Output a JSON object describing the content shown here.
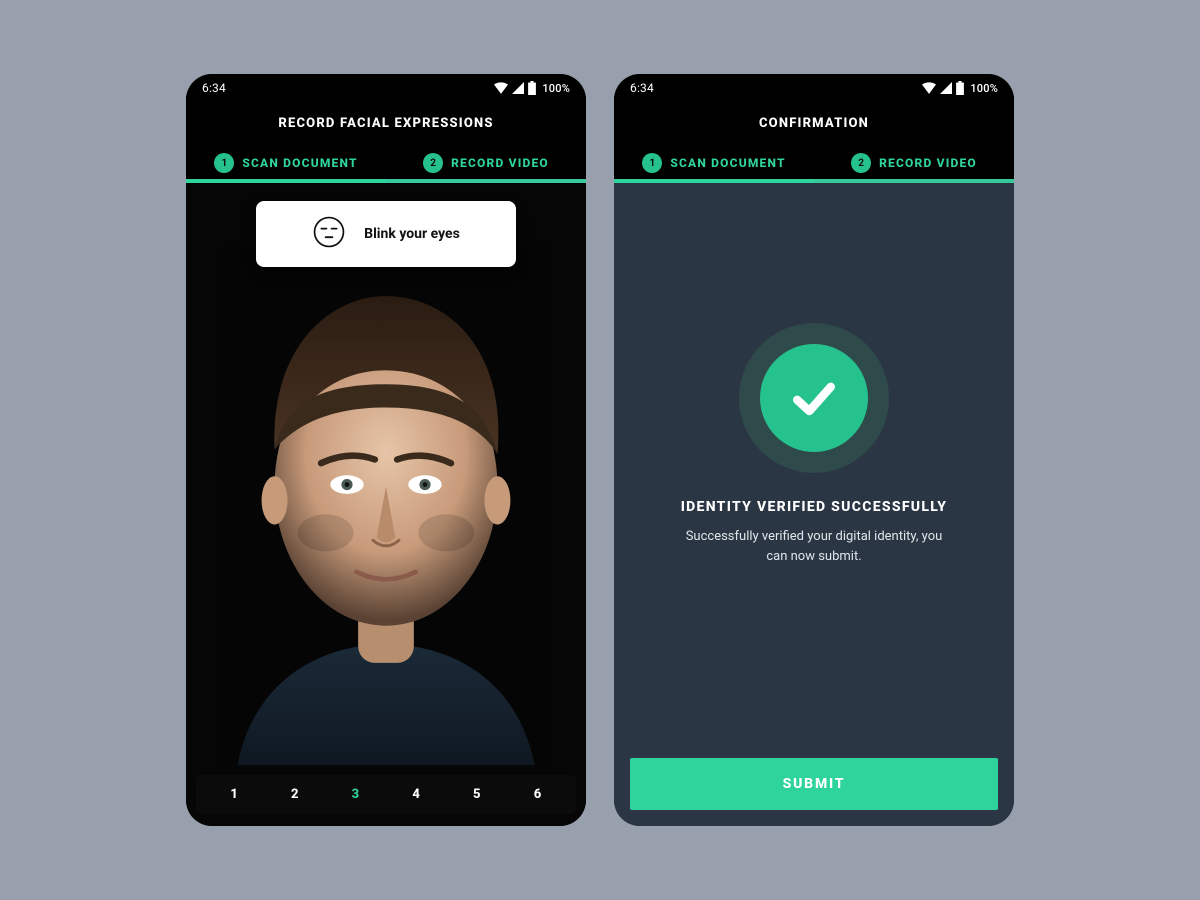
{
  "statusbar": {
    "time": "6:34",
    "battery": "100%"
  },
  "steps": [
    {
      "num": "1",
      "label": "SCAN DOCUMENT"
    },
    {
      "num": "2",
      "label": "RECORD VIDEO"
    }
  ],
  "screen1": {
    "title": "RECORD FACIAL EXPRESSIONS",
    "instruction": "Blink your eyes",
    "counter": [
      "1",
      "2",
      "3",
      "4",
      "5",
      "6"
    ],
    "active_index": 2
  },
  "screen2": {
    "title": "CONFIRMATION",
    "success_title": "IDENTITY VERIFIED SUCCESSFULLY",
    "success_sub": "Successfully verified your digital identity, you can now submit.",
    "submit_label": "SUBMIT"
  },
  "colors": {
    "accent": "#2fd49d",
    "accent_solid": "#26c28e",
    "dark": "#2b3644"
  }
}
